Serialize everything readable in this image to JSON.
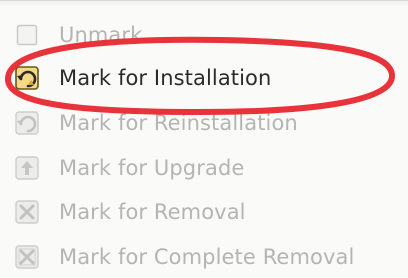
{
  "menu": {
    "items": [
      {
        "label": "Unmark",
        "icon": "checkbox-blank-icon",
        "enabled": false
      },
      {
        "label": "Mark for Installation",
        "icon": "install-package-icon",
        "enabled": true
      },
      {
        "label": "Mark for Reinstallation",
        "icon": "reinstall-package-icon",
        "enabled": false
      },
      {
        "label": "Mark for Upgrade",
        "icon": "upgrade-package-icon",
        "enabled": false
      },
      {
        "label": "Mark for Removal",
        "icon": "remove-package-icon",
        "enabled": false
      },
      {
        "label": "Mark for Complete Removal",
        "icon": "purge-package-icon",
        "enabled": false
      }
    ]
  },
  "annotation": {
    "color": "#e8333a",
    "shape": "ellipse",
    "target": "Mark for Installation"
  }
}
